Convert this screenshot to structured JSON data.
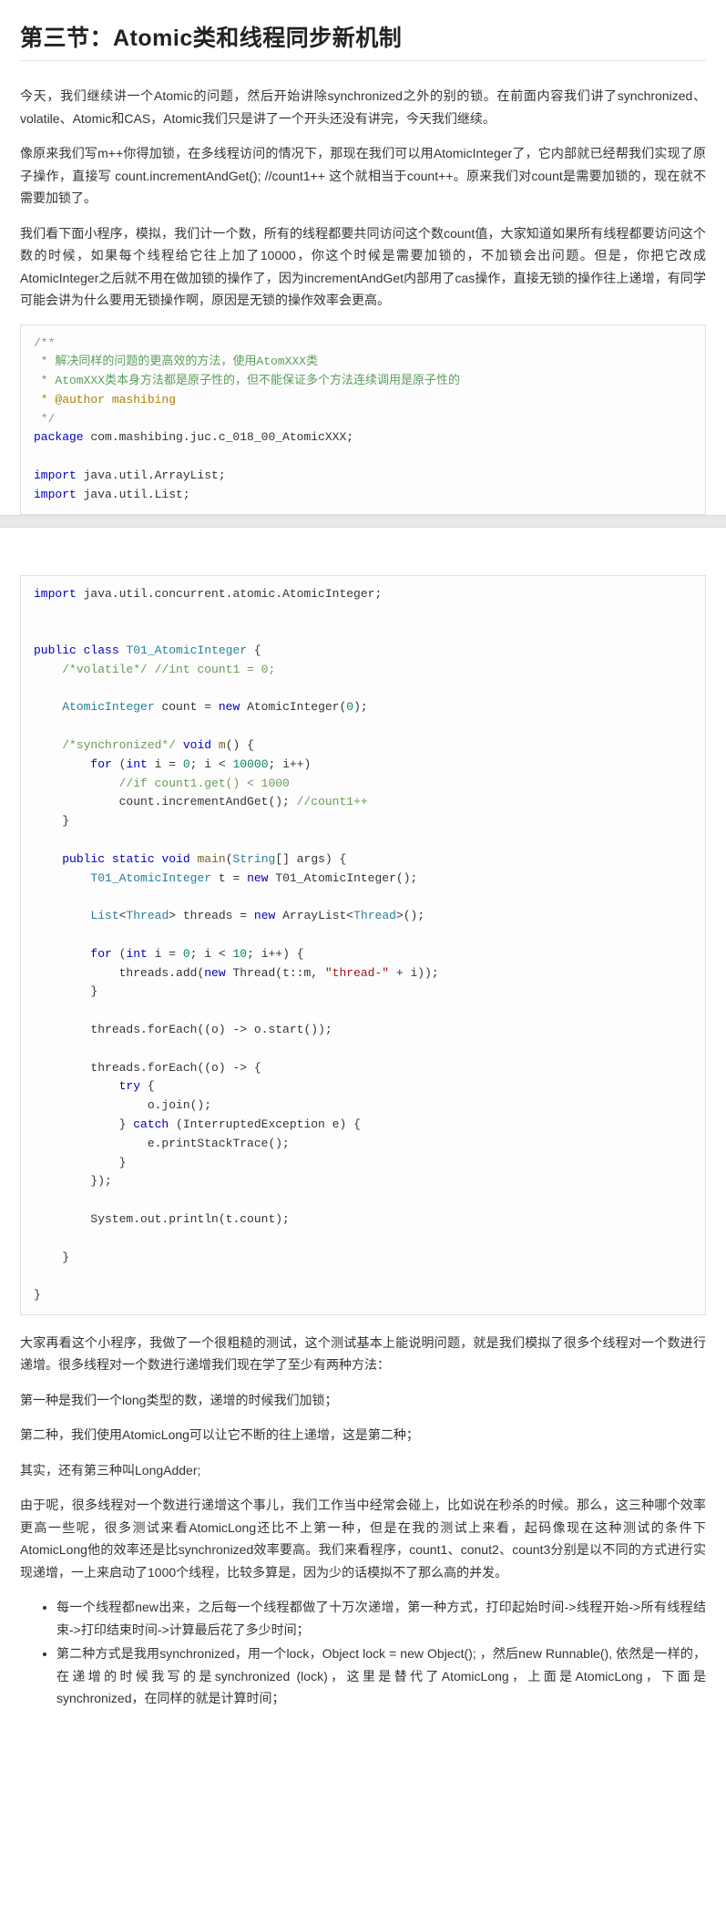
{
  "heading": "第三节：Atomic类和线程同步新机制",
  "p1": "今天，我们继续讲一个Atomic的问题，然后开始讲除synchronized之外的别的锁。在前面内容我们讲了synchronized、volatile、Atomic和CAS，Atomic我们只是讲了一个开头还没有讲完，今天我们继续。",
  "p2": "像原来我们写m++你得加锁，在多线程访问的情况下，那现在我们可以用AtomicInteger了，它内部就已经帮我们实现了原子操作，直接写 count.incrementAndGet(); //count1++ 这个就相当于count++。原来我们对count是需要加锁的，现在就不需要加锁了。",
  "p3": "我们看下面小程序，模拟，我们计一个数，所有的线程都要共同访问这个数count值，大家知道如果所有线程都要访问这个数的时候，如果每个线程给它往上加了10000，你这个时候是需要加锁的，不加锁会出问题。但是，你把它改成AtomicInteger之后就不用在做加锁的操作了，因为incrementAndGet内部用了cas操作，直接无锁的操作往上递增，有同学可能会讲为什么要用无锁操作啊，原因是无锁的操作效率会更高。",
  "code1": {
    "c1": "/**",
    "c2": " * 解决同样的问题的更高效的方法，使用AtomXXX类",
    "c3": " * AtomXXX类本身方法都是原子性的，但不能保证多个方法连续调用是原子性的",
    "c4": " * @author mashibing",
    "c5": " */",
    "pkg_kw": "package",
    "pkg_v": " com.mashibing.juc.c_018_00_AtomicXXX;",
    "imp_kw": "import",
    "imp1": " java.util.ArrayList;",
    "imp2": " java.util.List;"
  },
  "code2": {
    "imp_kw": "import",
    "imp3": " java.util.concurrent.atomic.AtomicInteger;",
    "pub": "public",
    "cls": "class",
    "clsname": "T01_AtomicInteger",
    "c_vol": "/*volatile*/",
    "c_int": " //int count1 = 0;",
    "ai": "AtomicInteger",
    "count": " count = ",
    "new": "new",
    "ai2": " AtomicInteger(",
    "zero": "0",
    "close": ");",
    "c_sync": "/*synchronized*/",
    "void": "void",
    "m": " m",
    "oparen": "() {",
    "for": "for",
    "int": "int",
    "i": " i = ",
    "lt": "; i < ",
    "tenk": "10000",
    "ipp": "; i++)",
    "c_if": "//if count1.get() < 1000",
    "inc": "count.incrementAndGet(); ",
    "c_c1": "//count1++",
    "static": "static",
    "main": " main",
    "string": "String",
    "args": "[] args) {",
    "tname": "T01_AtomicInteger",
    "t": " t = ",
    "tctor": " T01_AtomicInteger();",
    "list": "List",
    "thread": "Thread",
    "threads": "> threads = ",
    "arraylist": " ArrayList<",
    "tail": ">();",
    "ten": "10",
    "add": "threads.add(",
    "thrctor": " Thread(t::m, ",
    "tstr": "\"thread-\"",
    "plusi": " + i));",
    "foreach1": "threads.forEach((o) -> o.start());",
    "foreach2": "threads.forEach((o) -> {",
    "try": "try",
    "join": "o.join();",
    "catch": "catch",
    "exc": " (InterruptedException e) {",
    "pst": "e.printStackTrace();",
    "println": "System.out.println(t.count);"
  },
  "p4": "大家再看这个小程序，我做了一个很粗糙的测试，这个测试基本上能说明问题，就是我们模拟了很多个线程对一个数进行递增。很多线程对一个数进行递增我们现在学了至少有两种方法：",
  "p5": "第一种是我们一个long类型的数，递增的时候我们加锁；",
  "p6": "第二种，我们使用AtomicLong可以让它不断的往上递增，这是第二种；",
  "p7": "其实，还有第三种叫LongAdder;",
  "p8": "由于呢，很多线程对一个数进行递增这个事儿，我们工作当中经常会碰上，比如说在秒杀的时候。那么，这三种哪个效率更高一些呢，很多测试来看AtomicLong还比不上第一种，但是在我的测试上来看，起码像现在这种测试的条件下AtomicLong他的效率还是比synchronized效率要高。我们来看程序，count1、conut2、count3分别是以不同的方式进行实现递增，一上来启动了1000个线程，比较多算是，因为少的话模拟不了那么高的并发。",
  "li1": "每一个线程都new出来，之后每一个线程都做了十万次递增，第一种方式，打印起始时间->线程开始->所有线程结束->打印结束时间->计算最后花了多少时间；",
  "li2": "第二种方式是我用synchronized，用一个lock，Object lock = new Object(); ，然后new Runnable(), 依然是一样的，在递增的时候我写的是synchronized (lock)，这里是替代了AtomicLong，上面是AtomicLong，下面是synchronized，在同样的就是计算时间；"
}
